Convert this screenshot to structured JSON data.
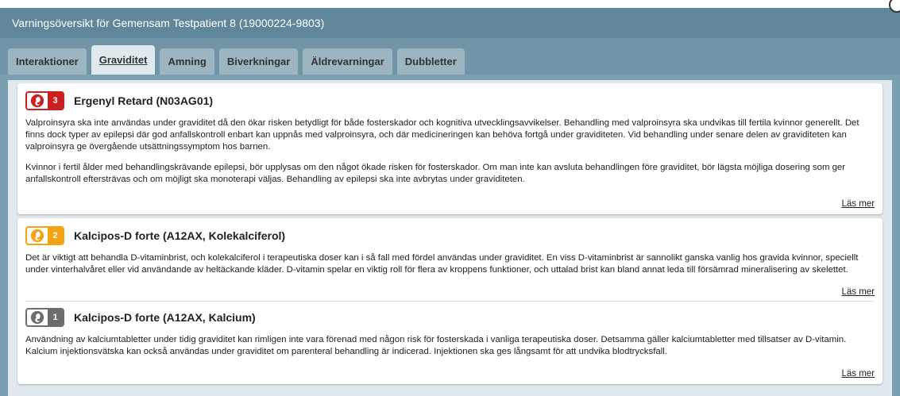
{
  "window": {
    "title": "Varningsöversikt för Gemensam Testpatient 8 (19000224-9803)"
  },
  "tabs": [
    {
      "label": "Interaktioner",
      "active": false
    },
    {
      "label": "Graviditet",
      "active": true
    },
    {
      "label": "Amning",
      "active": false
    },
    {
      "label": "Biverkningar",
      "active": false
    },
    {
      "label": "Äldrevarningar",
      "active": false
    },
    {
      "label": "Dubbletter",
      "active": false
    }
  ],
  "colors": {
    "level3": "#cc1f1f",
    "level2": "#f2a414",
    "level1": "#6d6d6d"
  },
  "warnings": [
    {
      "level": "3",
      "icon": "pregnancy-icon",
      "drug": "Ergenyl Retard (N03AG01)",
      "paragraphs": [
        "Valproinsyra ska inte användas under graviditet då den ökar risken betydligt för både fosterskador och kognitiva utvecklingsavvikelser. Behandling med valproinsyra ska undvikas till fertila kvinnor generellt. Det finns dock typer av epilepsi där god anfallskontroll enbart kan uppnås med valproinsyra, och där medicineringen kan behöva fortgå under graviditeten. Vid behandling under senare delen av graviditeten kan valproinsyra ge övergående utsättningssymptom hos barnen.",
        "Kvinnor i fertil ålder med behandlingskrävande epilepsi, bör upplysas om den något ökade risken för fosterskador. Om man inte kan avsluta behandlingen före graviditet, bör lägsta möjliga dosering som ger anfallskontroll eftersträvas och om möjligt ska monoterapi väljas. Behandling av epilepsi ska inte avbrytas under graviditeten."
      ],
      "more": "Läs mer"
    },
    {
      "level": "2",
      "icon": "pregnancy-icon",
      "drug": "Kalcipos-D forte (A12AX, Kolekalciferol)",
      "paragraphs": [
        "Det är viktigt att behandla D-vitaminbrist, och kolekalciferol i terapeutiska doser kan i så fall med fördel användas under graviditet. En viss D-vitaminbrist är sannolikt ganska vanlig hos gravida kvinnor, speciellt under vinterhalvåret eller vid användande av heltäckande kläder. D-vitamin spelar en viktig roll för flera av kroppens funktioner, och uttalad brist kan bland annat leda till försämrad mineralisering av skelettet."
      ],
      "more": "Läs mer"
    },
    {
      "level": "1",
      "icon": "pregnancy-icon",
      "drug": "Kalcipos-D forte (A12AX, Kalcium)",
      "paragraphs": [
        "Användning av kalciumtabletter under tidig graviditet kan rimligen inte vara förenad med någon risk för fosterskada i vanliga terapeutiska doser. Detsamma gäller kalciumtabletter med tillsatser av D-vitamin. Kalcium injektionsvätska kan också användas under graviditet om parenteral behandling är indicerad. Injektionen ska ges långsamt för att undvika blodtrycksfall."
      ],
      "more": "Läs mer"
    }
  ]
}
